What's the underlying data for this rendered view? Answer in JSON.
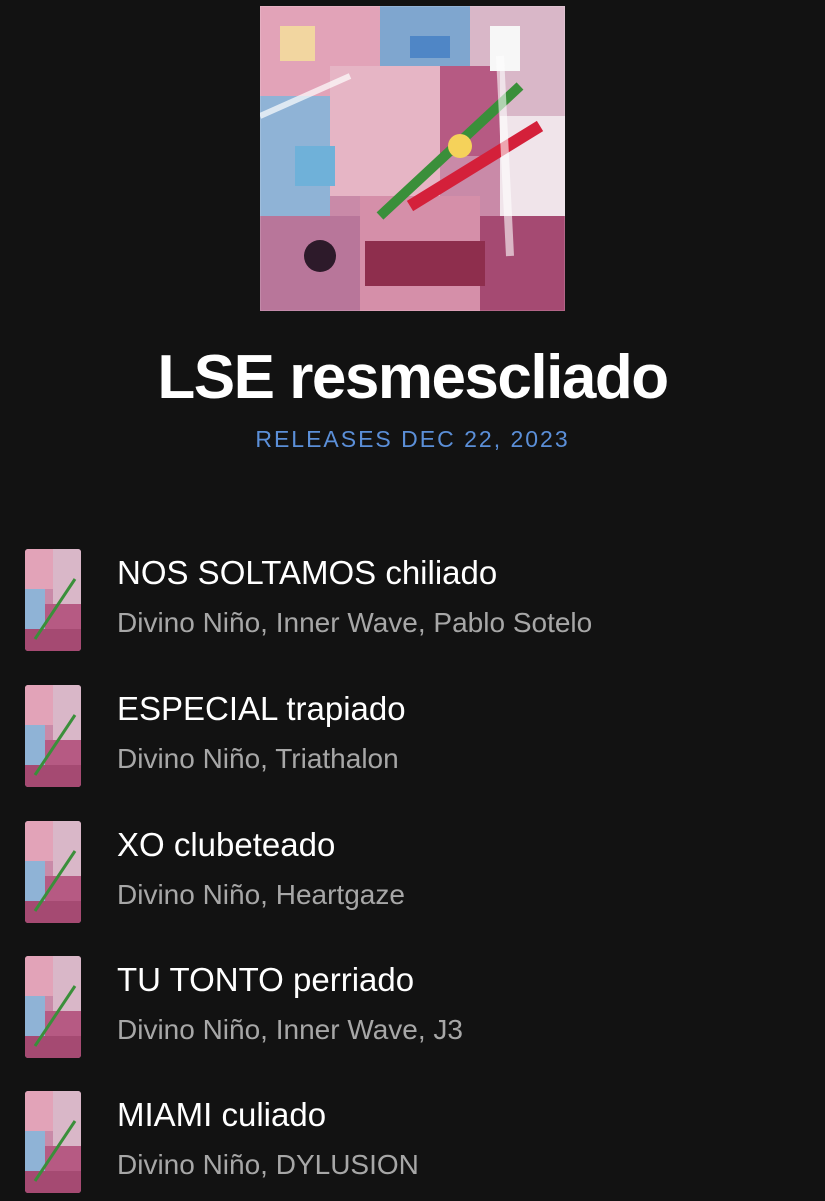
{
  "album": {
    "title": "LSE resmescliado",
    "release_text": "RELEASES DEC 22, 2023"
  },
  "colors": {
    "background": "#121212",
    "title": "#ffffff",
    "release_accent": "#5b8fd8",
    "artists_text": "#a7a7a7"
  },
  "tracks": [
    {
      "name": "NOS SOLTAMOS chiliado",
      "artists": "Divino Niño, Inner Wave, Pablo Sotelo"
    },
    {
      "name": "ESPECIAL trapiado",
      "artists": "Divino Niño, Triathalon"
    },
    {
      "name": "XO clubeteado",
      "artists": "Divino Niño, Heartgaze"
    },
    {
      "name": "TU TONTO perriado",
      "artists": "Divino Niño, Inner Wave, J3"
    },
    {
      "name": "MIAMI culiado",
      "artists": "Divino Niño, DYLUSION"
    }
  ]
}
